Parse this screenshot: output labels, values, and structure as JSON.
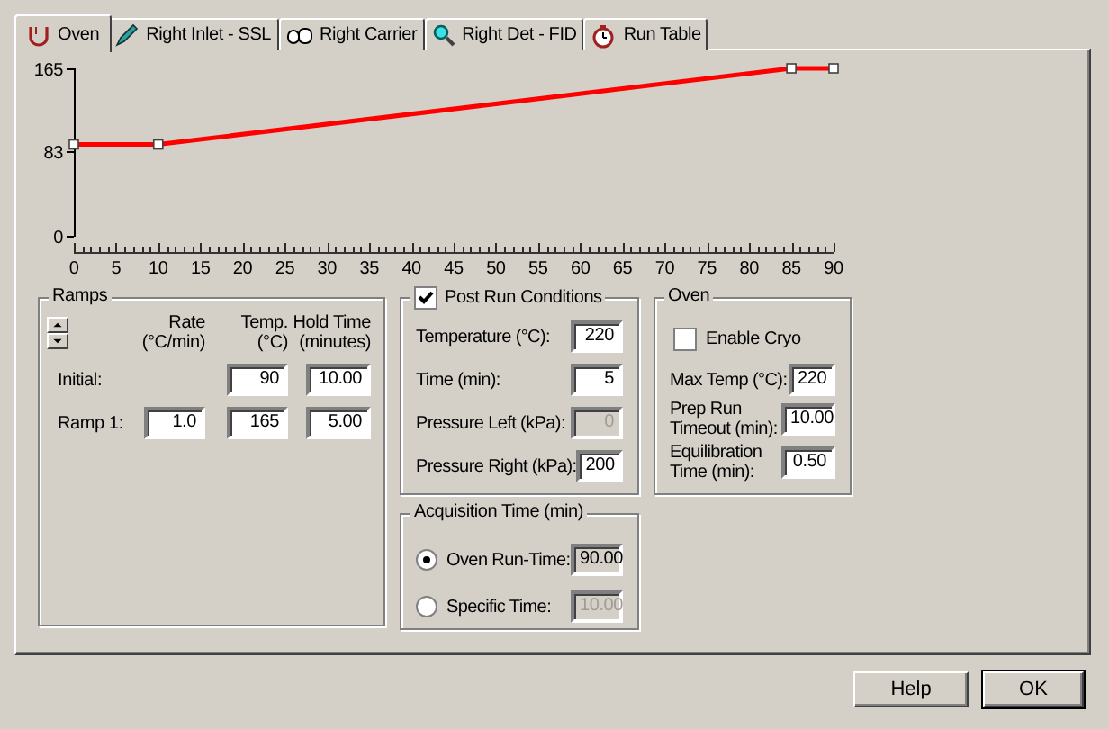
{
  "tabs": [
    {
      "label": "Oven",
      "selected": true
    },
    {
      "label": "Right Inlet - SSL",
      "selected": false
    },
    {
      "label": "Right Carrier",
      "selected": false
    },
    {
      "label": "Right Det - FID",
      "selected": false
    },
    {
      "label": "Run Table",
      "selected": false
    }
  ],
  "chart": {
    "chart_data": {
      "type": "line",
      "x": [
        0,
        10,
        85,
        90
      ],
      "series": [
        {
          "color": "#ff0000",
          "marker": "square",
          "values": [
            90,
            90,
            165,
            165
          ]
        }
      ],
      "xlim": [
        0,
        90
      ],
      "ylim": [
        0,
        165
      ],
      "xticks": [
        0,
        5,
        10,
        15,
        20,
        25,
        30,
        35,
        40,
        45,
        50,
        55,
        60,
        65,
        70,
        75,
        80,
        85,
        90
      ],
      "yticks": [
        0,
        83,
        165
      ]
    }
  },
  "ramps": {
    "title": "Ramps",
    "columns": [
      {
        "title": "Rate",
        "unit": "(°C/min)"
      },
      {
        "title": "Temp.",
        "unit": "(°C)"
      },
      {
        "title": "Hold Time",
        "unit": "(minutes)"
      }
    ],
    "rows": [
      {
        "label": "Initial:",
        "temp": "90",
        "hold": "10.00"
      },
      {
        "label": "Ramp 1:",
        "rate": "1.0",
        "temp": "165",
        "hold": "5.00"
      }
    ]
  },
  "post_run": {
    "title": "Post Run Conditions",
    "checked": true,
    "fields": [
      {
        "label": "Temperature (°C):",
        "value": "220",
        "disabled": false
      },
      {
        "label": "Time (min):",
        "value": "5",
        "disabled": false
      },
      {
        "label": "Pressure Left (kPa):",
        "value": "0",
        "disabled": true
      },
      {
        "label": "Pressure Right (kPa):",
        "value": "200",
        "disabled": false
      }
    ]
  },
  "acquisition": {
    "title": "Acquisition Time (min)",
    "options": [
      {
        "label": "Oven Run-Time:",
        "value": "90.00",
        "selected": true
      },
      {
        "label": "Specific Time:",
        "value": "10.00",
        "selected": false
      }
    ]
  },
  "oven": {
    "title": "Oven",
    "cryo": {
      "label": "Enable Cryo",
      "checked": false
    },
    "fields": [
      {
        "label": "Max Temp (°C):",
        "value": "220"
      },
      {
        "label": "Prep Run Timeout (min):",
        "value": "10.00"
      },
      {
        "label": "Equilibration Time (min):",
        "value": "0.50"
      }
    ]
  },
  "buttons": [
    "Help",
    "OK"
  ]
}
